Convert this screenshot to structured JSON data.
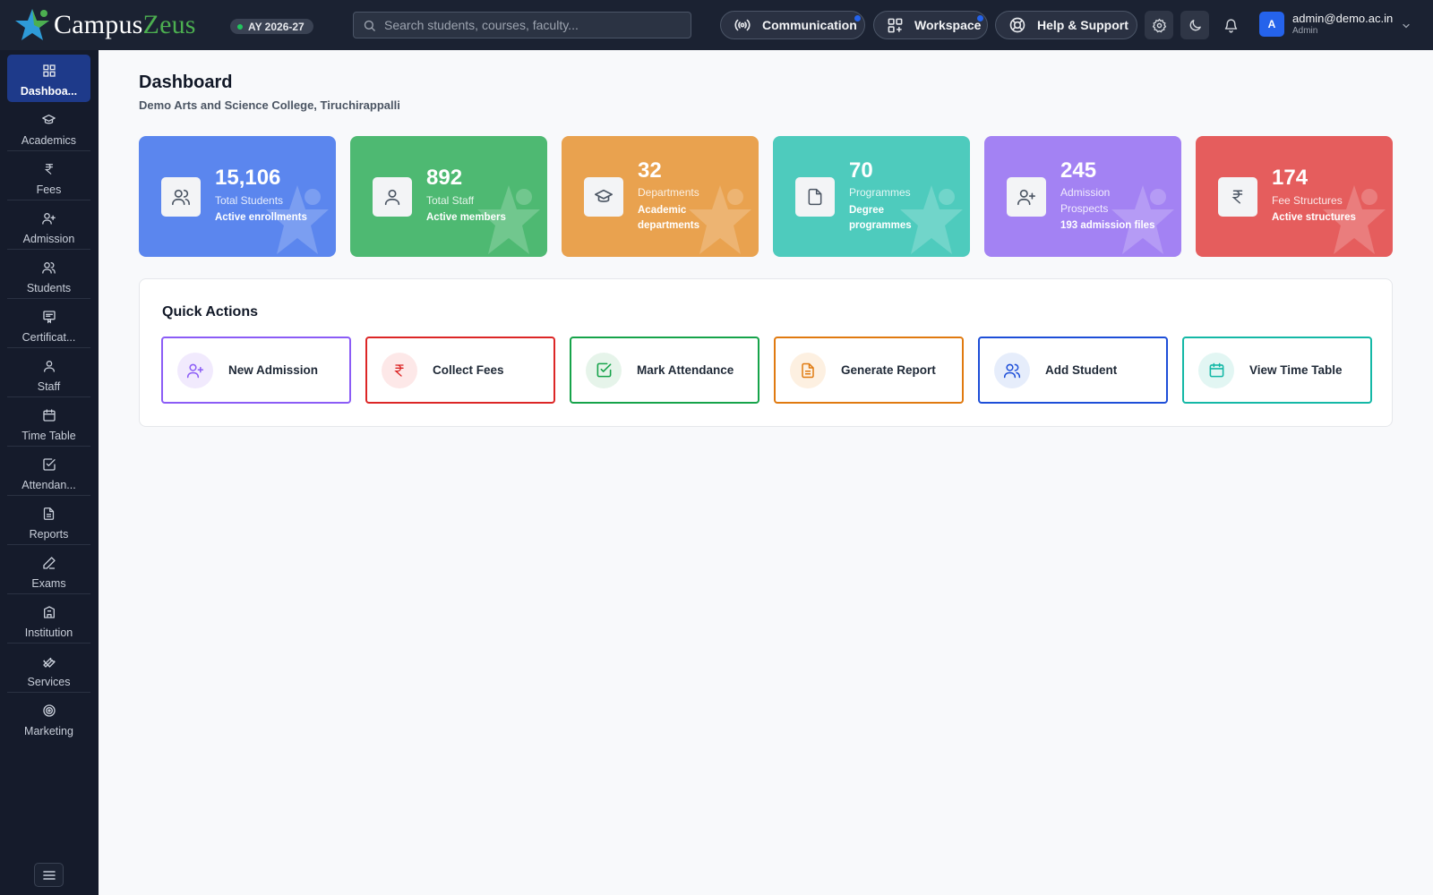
{
  "header": {
    "logo_part1": "Campus",
    "logo_part2": "Zeus",
    "academic_year": "AY 2026-27",
    "search_placeholder": "Search students, courses, faculty...",
    "communication_label": "Communication",
    "workspace_label": "Workspace",
    "help_label": "Help & Support",
    "user_initial": "A",
    "user_email": "admin@demo.ac.in",
    "user_role": "Admin"
  },
  "sidebar": {
    "items": [
      {
        "label": "Dashboa...",
        "icon": "dashboard-icon"
      },
      {
        "label": "Academics",
        "icon": "graduation-cap-icon"
      },
      {
        "label": "Fees",
        "icon": "rupee-icon"
      },
      {
        "label": "Admission",
        "icon": "user-plus-icon"
      },
      {
        "label": "Students",
        "icon": "users-icon"
      },
      {
        "label": "Certificat...",
        "icon": "certificate-icon"
      },
      {
        "label": "Staff",
        "icon": "user-icon"
      },
      {
        "label": "Time Table",
        "icon": "calendar-icon"
      },
      {
        "label": "Attendan...",
        "icon": "check-square-icon"
      },
      {
        "label": "Reports",
        "icon": "file-text-icon"
      },
      {
        "label": "Exams",
        "icon": "pen-icon"
      },
      {
        "label": "Institution",
        "icon": "building-icon"
      },
      {
        "label": "Services",
        "icon": "wrench-icon"
      },
      {
        "label": "Marketing",
        "icon": "target-icon"
      }
    ]
  },
  "page": {
    "title": "Dashboard",
    "subtitle": "Demo Arts and Science College, Tiruchirappalli"
  },
  "stats": [
    {
      "value": "15,106",
      "label": "Total Students",
      "note": "Active enrollments",
      "color": "#5b86ee",
      "icon": "users-icon"
    },
    {
      "value": "892",
      "label": "Total Staff",
      "note": "Active members",
      "color": "#4eb972",
      "icon": "user-icon"
    },
    {
      "value": "32",
      "label": "Departments",
      "note": "Academic departments",
      "color": "#e9a24f",
      "icon": "graduation-cap-icon"
    },
    {
      "value": "70",
      "label": "Programmes",
      "note": "Degree programmes",
      "color": "#4ecbbd",
      "icon": "file-icon"
    },
    {
      "value": "245",
      "label": "Admission Prospects",
      "note": "193 admission files",
      "color": "#a382f3",
      "icon": "user-plus-icon"
    },
    {
      "value": "174",
      "label": "Fee Structures",
      "note": "Active structures",
      "color": "#e55d5d",
      "icon": "rupee-icon"
    }
  ],
  "quick_actions": {
    "title": "Quick Actions",
    "items": [
      {
        "label": "New Admission",
        "color": "#8b5cf6",
        "bg": "#f1eafd",
        "icon": "user-plus-icon"
      },
      {
        "label": "Collect Fees",
        "color": "#dc2626",
        "bg": "#fde8e8",
        "icon": "rupee-icon"
      },
      {
        "label": "Mark Attendance",
        "color": "#16a34a",
        "bg": "#e6f4ea",
        "icon": "check-square-icon"
      },
      {
        "label": "Generate Report",
        "color": "#e07a10",
        "bg": "#fdf0e1",
        "icon": "file-text-icon"
      },
      {
        "label": "Add Student",
        "color": "#1d4ed8",
        "bg": "#e6edfb",
        "icon": "users-icon"
      },
      {
        "label": "View Time Table",
        "color": "#14b8a6",
        "bg": "#e2f6f3",
        "icon": "calendar-icon"
      }
    ]
  }
}
